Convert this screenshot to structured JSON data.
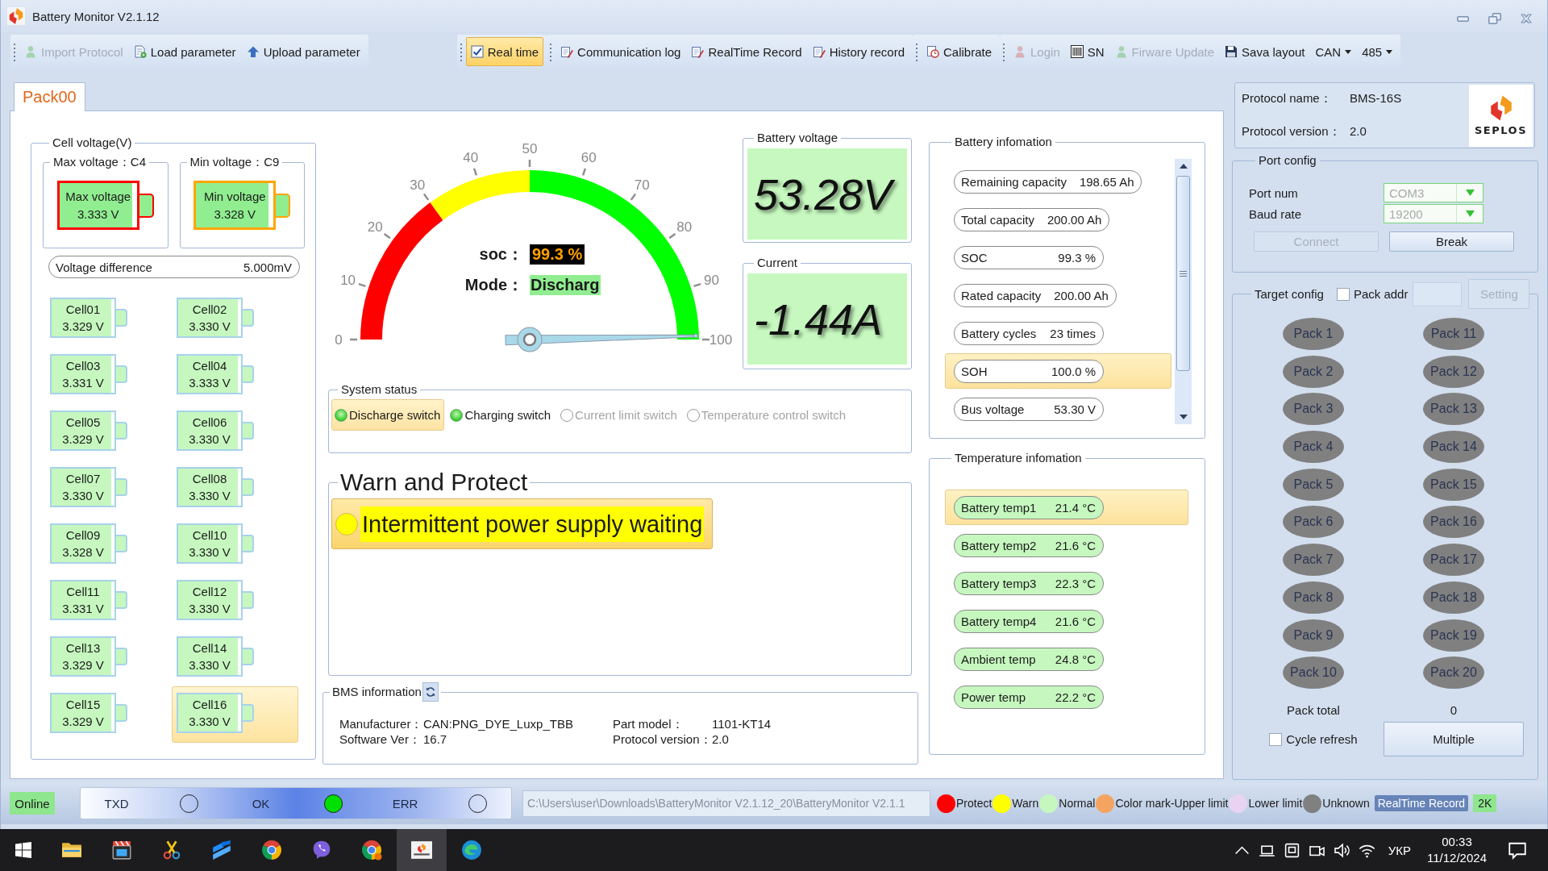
{
  "window": {
    "title": "Battery Monitor V2.1.12"
  },
  "toolbar": {
    "groups": [
      {
        "items": [
          {
            "kind": "button",
            "label": "Import Protocol",
            "disabled": true
          },
          {
            "kind": "button",
            "label": "Load parameter",
            "disabled": false
          },
          {
            "kind": "button",
            "label": "Upload parameter",
            "disabled": false
          }
        ]
      },
      {
        "items": [
          {
            "kind": "toggle",
            "label": "Real time",
            "disabled": false,
            "checked": true
          }
        ]
      },
      {
        "items": [
          {
            "kind": "button",
            "label": "Communication log",
            "disabled": false
          },
          {
            "kind": "button",
            "label": "RealTime Record",
            "disabled": false
          },
          {
            "kind": "button",
            "label": "History record",
            "disabled": false
          }
        ]
      },
      {
        "items": [
          {
            "kind": "button",
            "label": "Calibrate",
            "disabled": false
          }
        ]
      },
      {
        "items": [
          {
            "kind": "button",
            "label": "Login",
            "disabled": true
          },
          {
            "kind": "button",
            "label": "SN",
            "disabled": false
          },
          {
            "kind": "button",
            "label": "Firware Update",
            "disabled": true
          },
          {
            "kind": "button",
            "label": "Sava layout",
            "disabled": false
          },
          {
            "kind": "dropdown",
            "label": "CAN",
            "disabled": false
          },
          {
            "kind": "dropdown",
            "label": "485",
            "disabled": false
          }
        ]
      }
    ]
  },
  "tabs": [
    {
      "label": "Pack00",
      "selected": true
    }
  ],
  "cell_voltage": {
    "title": "Cell voltage(V)",
    "extremes": [
      {
        "title": "Max voltage：C4",
        "label": "Max voltage",
        "value": "3.333 V",
        "color": "#ff0000"
      },
      {
        "title": "Min voltage：C9",
        "label": "Min voltage",
        "value": "3.328 V",
        "color": "#ffa500"
      }
    ],
    "difference": {
      "label": "Voltage difference",
      "value": "5.000mV"
    },
    "cells": [
      {
        "name": "Cell01",
        "voltage": "3.329 V",
        "color": "#c6f7bf",
        "selected": false
      },
      {
        "name": "Cell02",
        "voltage": "3.330 V",
        "color": "#c6f7bf",
        "selected": false
      },
      {
        "name": "Cell03",
        "voltage": "3.331 V",
        "color": "#c6f7bf",
        "selected": false
      },
      {
        "name": "Cell04",
        "voltage": "3.333 V",
        "color": "#c6f7bf",
        "selected": false
      },
      {
        "name": "Cell05",
        "voltage": "3.329 V",
        "color": "#c6f7bf",
        "selected": false
      },
      {
        "name": "Cell06",
        "voltage": "3.330 V",
        "color": "#c6f7bf",
        "selected": false
      },
      {
        "name": "Cell07",
        "voltage": "3.330 V",
        "color": "#c6f7bf",
        "selected": false
      },
      {
        "name": "Cell08",
        "voltage": "3.330 V",
        "color": "#c6f7bf",
        "selected": false
      },
      {
        "name": "Cell09",
        "voltage": "3.328 V",
        "color": "#c6f7bf",
        "selected": false
      },
      {
        "name": "Cell10",
        "voltage": "3.330 V",
        "color": "#c6f7bf",
        "selected": false
      },
      {
        "name": "Cell11",
        "voltage": "3.331 V",
        "color": "#c6f7bf",
        "selected": false
      },
      {
        "name": "Cell12",
        "voltage": "3.330 V",
        "color": "#c6f7bf",
        "selected": false
      },
      {
        "name": "Cell13",
        "voltage": "3.329 V",
        "color": "#c6f7bf",
        "selected": false
      },
      {
        "name": "Cell14",
        "voltage": "3.330 V",
        "color": "#c6f7bf",
        "selected": false
      },
      {
        "name": "Cell15",
        "voltage": "3.329 V",
        "color": "#c6f7bf",
        "selected": false
      },
      {
        "name": "Cell16",
        "voltage": "3.330 V",
        "color": "#c6f7bf",
        "selected": true
      }
    ]
  },
  "gauge": {
    "ticks": [
      "0",
      "10",
      "20",
      "30",
      "40",
      "50",
      "60",
      "70",
      "80",
      "90",
      "100"
    ],
    "level": 0.993,
    "soc_label": "soc：",
    "soc_value": "99.3 %",
    "mode_label": "Mode：",
    "mode_value": "Discharg"
  },
  "readouts": [
    {
      "title": "Battery voltage",
      "value": "53.28V"
    },
    {
      "title": "Current",
      "value": "-1.44A"
    }
  ],
  "system_status": {
    "title": "System status",
    "switches": [
      {
        "label": "Discharge switch",
        "on": true,
        "selected": true
      },
      {
        "label": "Charging switch",
        "on": true,
        "selected": false
      },
      {
        "label": "Current limit switch",
        "on": false,
        "selected": false
      },
      {
        "label": "Temperature control switch",
        "on": false,
        "selected": false
      }
    ]
  },
  "warnings": {
    "title": "Warn and Protect",
    "items": [
      {
        "text": "Intermittent power supply waiting",
        "color": "#ffff00",
        "selected": true
      }
    ]
  },
  "bms_info": {
    "title": "BMS information",
    "fields": [
      {
        "label": "Manufacturer：",
        "value": "CAN:PNG_DYE_Luxp_TBB"
      },
      {
        "label": "Part model：",
        "value": "1101-KT14"
      },
      {
        "label": "Software Ver：",
        "value": "16.7"
      },
      {
        "label": "Protocol version：",
        "value": "2.0"
      }
    ]
  },
  "battery_info": {
    "title": "Battery infomation",
    "rows": [
      {
        "label": "Remaining capacity",
        "value": "198.65 Ah",
        "selected": false
      },
      {
        "label": "Total capacity",
        "value": "200.00 Ah",
        "selected": false
      },
      {
        "label": "SOC",
        "value": "99.3 %",
        "selected": false
      },
      {
        "label": "Rated capacity",
        "value": "200.00 Ah",
        "selected": false
      },
      {
        "label": "Battery cycles",
        "value": "23 times",
        "selected": false
      },
      {
        "label": "SOH",
        "value": "100.0 %",
        "selected": true
      },
      {
        "label": "Bus voltage",
        "value": "53.30 V",
        "selected": false
      }
    ]
  },
  "temperature_info": {
    "title": "Temperature infomation",
    "rows": [
      {
        "label": "Battery temp1",
        "value": "21.4 °C",
        "color": "#c6f7bf",
        "selected": true
      },
      {
        "label": "Battery temp2",
        "value": "21.6 °C",
        "color": "#c6f7bf",
        "selected": false
      },
      {
        "label": "Battery temp3",
        "value": "22.3 °C",
        "color": "#c6f7bf",
        "selected": false
      },
      {
        "label": "Battery temp4",
        "value": "21.6 °C",
        "color": "#c6f7bf",
        "selected": false
      },
      {
        "label": "Ambient temp",
        "value": "24.8 °C",
        "color": "#c6f7bf",
        "selected": false
      },
      {
        "label": "Power temp",
        "value": "22.2 °C",
        "color": "#c6f7bf",
        "selected": false
      }
    ]
  },
  "protocol": {
    "fields": [
      {
        "label": "Protocol name：",
        "value": "BMS-16S"
      },
      {
        "label": "Protocol version：",
        "value": "2.0"
      }
    ],
    "logo_text": "SEPLOS"
  },
  "port_config": {
    "title": "Port config",
    "fields": [
      {
        "label": "Port num",
        "value": "COM3",
        "disabled": true
      },
      {
        "label": "Baud rate",
        "value": "19200",
        "disabled": true
      }
    ],
    "buttons": [
      {
        "label": "Connect",
        "disabled": true
      },
      {
        "label": "Break",
        "disabled": false
      }
    ]
  },
  "target_config": {
    "title": "Target config",
    "pack_addr": {
      "label": "Pack addr",
      "checked": false
    },
    "setting_button": {
      "label": "Setting",
      "disabled": true
    },
    "packs": [
      {
        "label": "Pack 1",
        "color": "#808080"
      },
      {
        "label": "Pack 2",
        "color": "#808080"
      },
      {
        "label": "Pack 3",
        "color": "#808080"
      },
      {
        "label": "Pack 4",
        "color": "#808080"
      },
      {
        "label": "Pack 5",
        "color": "#808080"
      },
      {
        "label": "Pack 6",
        "color": "#808080"
      },
      {
        "label": "Pack 7",
        "color": "#808080"
      },
      {
        "label": "Pack 8",
        "color": "#808080"
      },
      {
        "label": "Pack 9",
        "color": "#808080"
      },
      {
        "label": "Pack 10",
        "color": "#808080"
      },
      {
        "label": "Pack 11",
        "color": "#808080"
      },
      {
        "label": "Pack 12",
        "color": "#808080"
      },
      {
        "label": "Pack 13",
        "color": "#808080"
      },
      {
        "label": "Pack 14",
        "color": "#808080"
      },
      {
        "label": "Pack 15",
        "color": "#808080"
      },
      {
        "label": "Pack 16",
        "color": "#808080"
      },
      {
        "label": "Pack 17",
        "color": "#808080"
      },
      {
        "label": "Pack 18",
        "color": "#808080"
      },
      {
        "label": "Pack 19",
        "color": "#808080"
      },
      {
        "label": "Pack 20",
        "color": "#808080"
      }
    ],
    "pack_total": {
      "label": "Pack total",
      "value": "0"
    },
    "cycle_refresh": {
      "label": "Cycle refresh",
      "checked": false
    },
    "multiple_button": {
      "label": "Multiple"
    }
  },
  "status_bar": {
    "connection": "Online",
    "indicators": [
      {
        "label": "TXD",
        "on": false
      },
      {
        "label": "OK",
        "on": true
      },
      {
        "label": "ERR",
        "on": false
      }
    ],
    "path": "C:\\Users\\user\\Downloads\\BatteryMonitor V2.1.12_20\\BatteryMonitor V2.1.1",
    "legend": [
      {
        "label": "Protect",
        "color": "#ff0000"
      },
      {
        "label": "Warn",
        "color": "#ffff00"
      },
      {
        "label": "Normal",
        "color": "#c6f7bf"
      },
      {
        "label": "Color mark-Upper limit",
        "color": "#f4a460"
      },
      {
        "label": "Lower limit",
        "color": "#e8d4f2"
      },
      {
        "label": "Unknown",
        "color": "#808080"
      }
    ],
    "record_label": "RealTime Record",
    "badge": "2K"
  },
  "taskbar": {
    "apps": [
      {
        "selected": false
      },
      {
        "selected": false
      },
      {
        "selected": false
      },
      {
        "selected": false
      },
      {
        "selected": false
      },
      {
        "selected": false
      },
      {
        "selected": false
      },
      {
        "selected": true
      },
      {
        "selected": false
      }
    ],
    "language": "УКР",
    "time": "00:33",
    "date": "11/12/2024"
  }
}
